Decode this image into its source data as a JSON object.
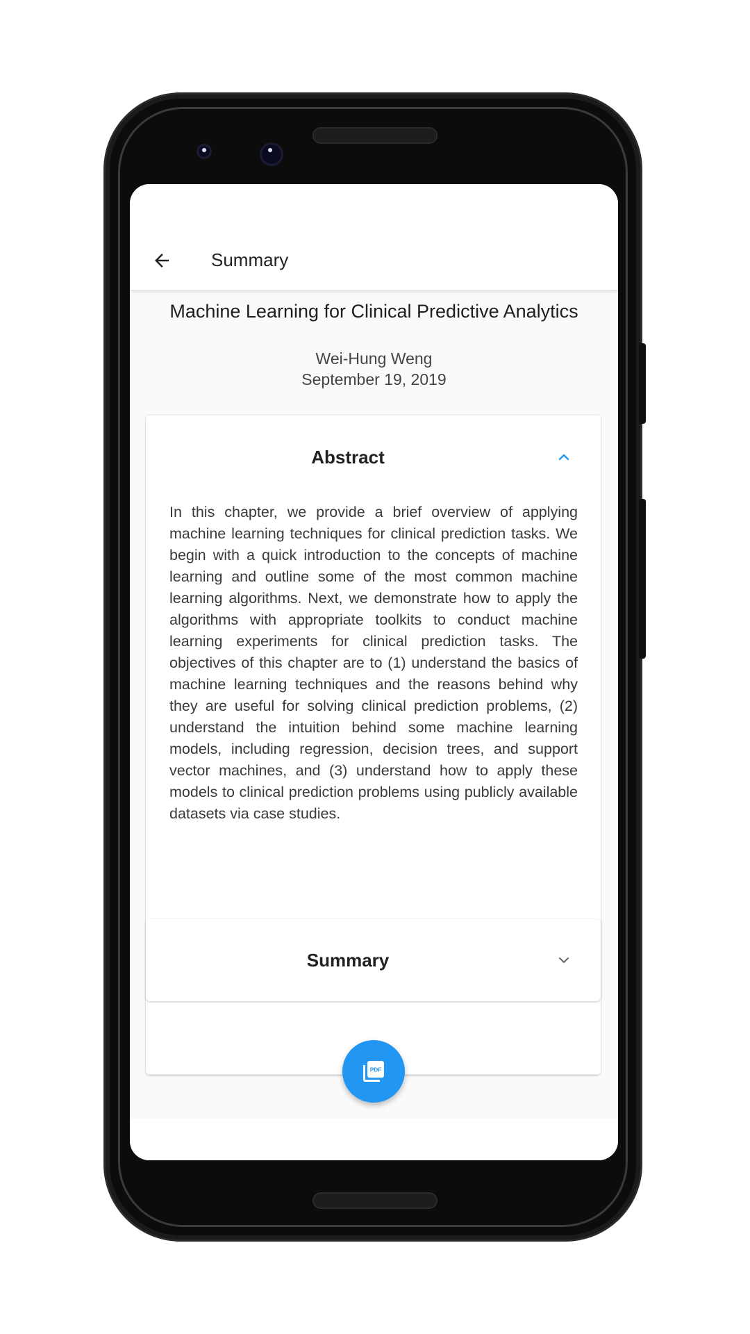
{
  "appbar": {
    "title": "Summary"
  },
  "paper": {
    "title": "Machine Learning for Clinical Predictive Analytics",
    "author": "Wei-Hung Weng",
    "date": "September 19, 2019"
  },
  "abstract_section": {
    "label": "Abstract",
    "expanded": true,
    "text": "In this chapter, we provide a brief overview of applying machine learning techniques for clinical prediction tasks. We begin with a quick introduction to the concepts of machine learning and outline some of the most common machine learning algorithms. Next, we demonstrate how to apply the algorithms with appropriate toolkits to conduct machine learning experiments for clinical prediction tasks. The objectives of this chapter are to (1) understand the basics of machine learning techniques and the reasons behind why they are useful for solving clinical prediction problems, (2) understand the intuition behind some machine learning models, including regression, decision trees, and support vector machines, and (3) understand how to apply these models to clinical prediction problems using publicly available datasets via case studies."
  },
  "summary_section": {
    "label": "Summary",
    "expanded": false
  },
  "fab": {
    "icon": "pdf-icon",
    "label": "PDF",
    "color": "#2196f3"
  },
  "colors": {
    "accent": "#2196f3",
    "background": "#fafafa"
  }
}
